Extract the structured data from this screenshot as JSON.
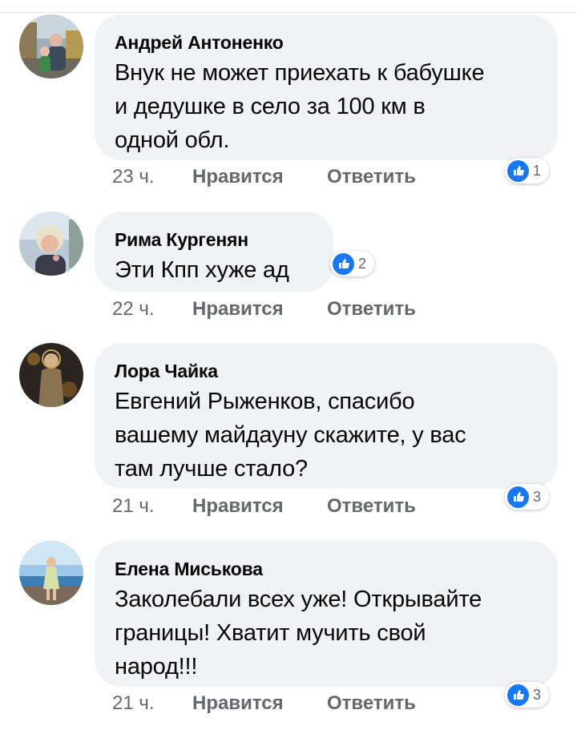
{
  "comments": [
    {
      "author": "Андрей Антоненко",
      "text": "Внук не может приехать к бабушке\nи дедушке в село за 100 км в\nодной обл.",
      "time": "23 ч.",
      "like_label": "Нравится",
      "reply_label": "Ответить",
      "reactions": "1",
      "reaction_icon": "thumbs-up-icon"
    },
    {
      "author": "Рима Кургенян",
      "text": "Эти Кпп хуже ад",
      "time": "22 ч.",
      "like_label": "Нравится",
      "reply_label": "Ответить",
      "reactions": "2",
      "reaction_icon": "thumbs-up-icon"
    },
    {
      "author": "Лора Чайка",
      "text": "Евгений Рыженков, спасибо\nвашему майдауну скажите, у вас\nтам лучше стало?",
      "time": "21 ч.",
      "like_label": "Нравится",
      "reply_label": "Ответить",
      "reactions": "3",
      "reaction_icon": "thumbs-up-icon"
    },
    {
      "author": "Елена Миськова",
      "text": "Заколебали всех уже! Открывайте\nграницы! Хватит мучить свой\nнарод!!!",
      "time": "21 ч.",
      "like_label": "Нравится",
      "reply_label": "Ответить",
      "reactions": "3",
      "reaction_icon": "thumbs-up-icon"
    }
  ],
  "colors": {
    "bubble": "#f0f2f5",
    "meta_text": "#65676b",
    "like_blue": "#1877f2"
  }
}
